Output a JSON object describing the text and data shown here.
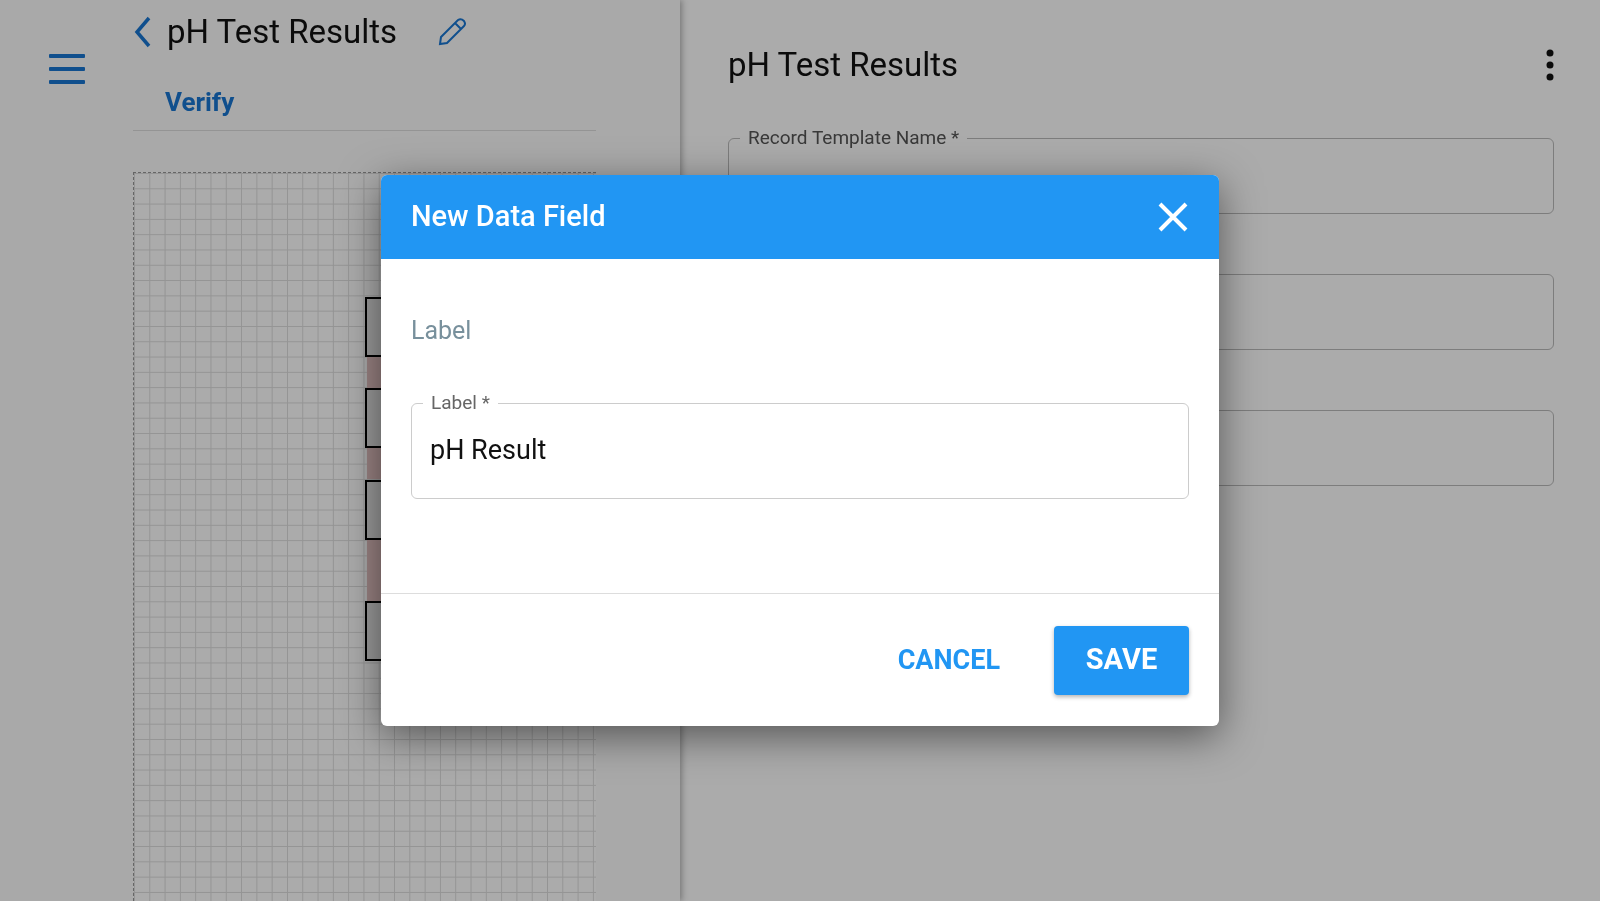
{
  "left_panel": {
    "title": "pH Test Results",
    "tabs": [
      {
        "label": "Verify",
        "selected": true
      }
    ]
  },
  "right_panel": {
    "title": "pH Test Results",
    "fields": [
      {
        "kind": "labeled",
        "label": "Record Template Name *"
      },
      {
        "kind": "blank"
      },
      {
        "kind": "blank"
      }
    ]
  },
  "dialog": {
    "title": "New Data Field",
    "section": "Label",
    "field": {
      "label": "Label *",
      "value": "pH Result"
    },
    "buttons": [
      {
        "kind": "text",
        "label": "CANCEL"
      },
      {
        "kind": "primary",
        "label": "SAVE"
      }
    ]
  }
}
